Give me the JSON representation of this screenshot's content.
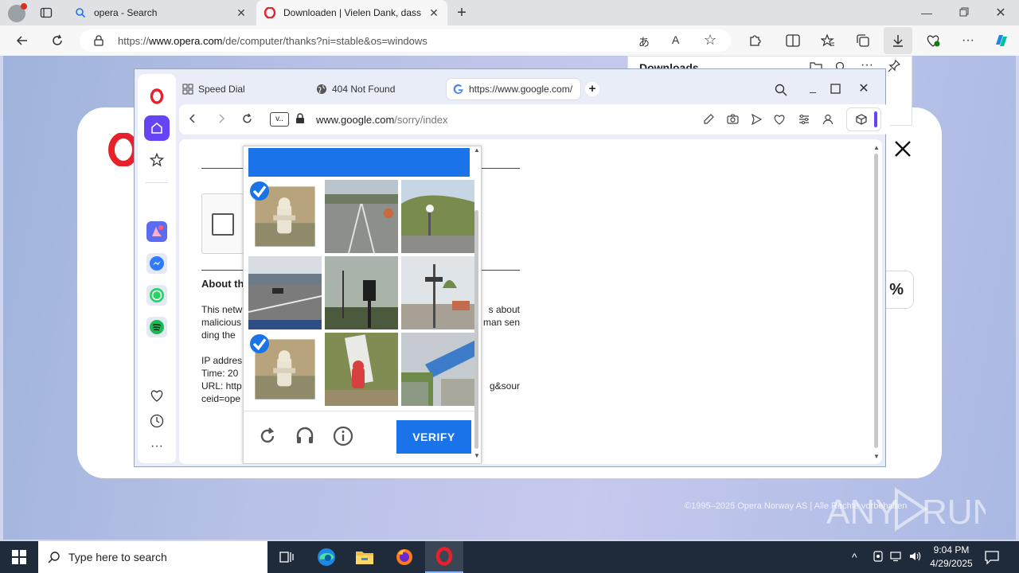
{
  "edge": {
    "tabs": [
      {
        "label": "opera - Search",
        "icon": "search-icon"
      },
      {
        "label": "Downloaden | Vielen Dank, dass Sie",
        "icon": "opera-logo-icon"
      }
    ],
    "url_prefix": "https://",
    "url_host": "www.opera.com",
    "url_path": "/de/computer/thanks?ni=stable&os=windows",
    "downloads_title": "Downloads"
  },
  "opera_page": {
    "percent_fragment": "%",
    "copyright": "©1995–2025 Opera Norway AS | Alle Rechte vorbehalten"
  },
  "opera_browser": {
    "tabs": [
      {
        "label": "Speed Dial"
      },
      {
        "label": "404 Not Found"
      },
      {
        "label": "https://www.google.com/"
      }
    ],
    "version_badge": "v..",
    "address_host": "www.google.com",
    "address_path": "/sorry/index"
  },
  "sorry_page": {
    "about_heading": "About th",
    "para_left": [
      "This netw",
      "malicious",
      "ding the"
    ],
    "para_right": [
      "s about",
      "man sen"
    ],
    "info_left": [
      "IP addres",
      "Time: 20",
      "URL: http",
      "ceid=ope"
    ],
    "info_right": [
      "g&sour"
    ]
  },
  "captcha": {
    "verify_label": "VERIFY",
    "tiles": [
      {
        "scene": "fire-hydrant",
        "selected": true
      },
      {
        "scene": "road",
        "selected": false
      },
      {
        "scene": "roadside-hill",
        "selected": false
      },
      {
        "scene": "highway",
        "selected": false
      },
      {
        "scene": "traffic-light",
        "selected": false
      },
      {
        "scene": "street-pole",
        "selected": false
      },
      {
        "scene": "fire-hydrant",
        "selected": true
      },
      {
        "scene": "hydrant-post",
        "selected": false
      },
      {
        "scene": "stairs",
        "selected": false
      }
    ]
  },
  "taskbar": {
    "search_placeholder": "Type here to search",
    "time": "9:04 PM",
    "date": "4/29/2025"
  },
  "watermark": "ANY RUN",
  "colors": {
    "captcha_blue": "#1a73e8",
    "opera_red": "#e8202a",
    "opera_purple": "#6644f5"
  }
}
